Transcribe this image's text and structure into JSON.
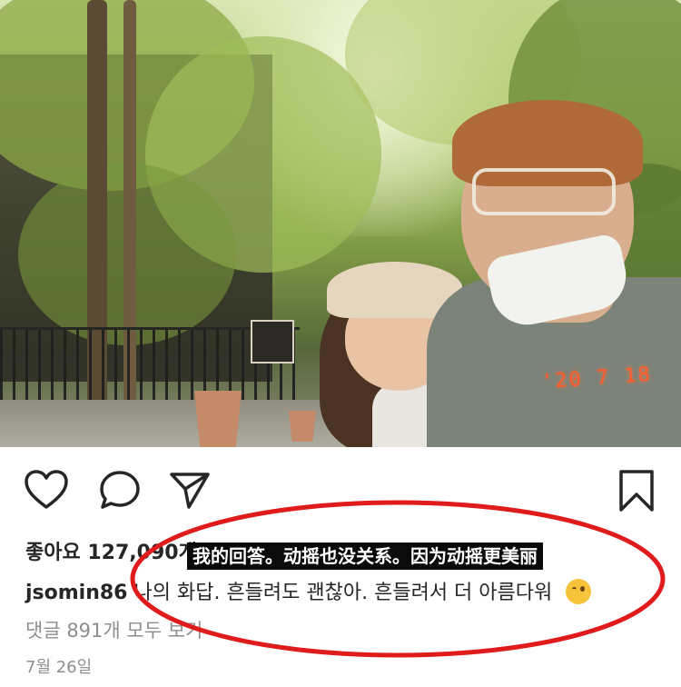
{
  "photo": {
    "film_date": "'20 7 18"
  },
  "actions": {
    "like_icon": "heart-outline",
    "comment_icon": "speech-bubble",
    "share_icon": "paper-plane",
    "save_icon": "bookmark-outline"
  },
  "post": {
    "likes_text": "좋아요 127,090개",
    "username": "jsomin86",
    "caption": "나의 화답. 흔들려도 괜찮아. 흔들려서 더 아름다워",
    "caption_emoji": "winking-face",
    "view_comments": "댓글 891개 모두 보기",
    "date": "7월 26일"
  },
  "overlay": {
    "subtitle": "我的回答。动摇也没关系。因为动摇更美丽",
    "annotation_color": "#e01b1b"
  }
}
